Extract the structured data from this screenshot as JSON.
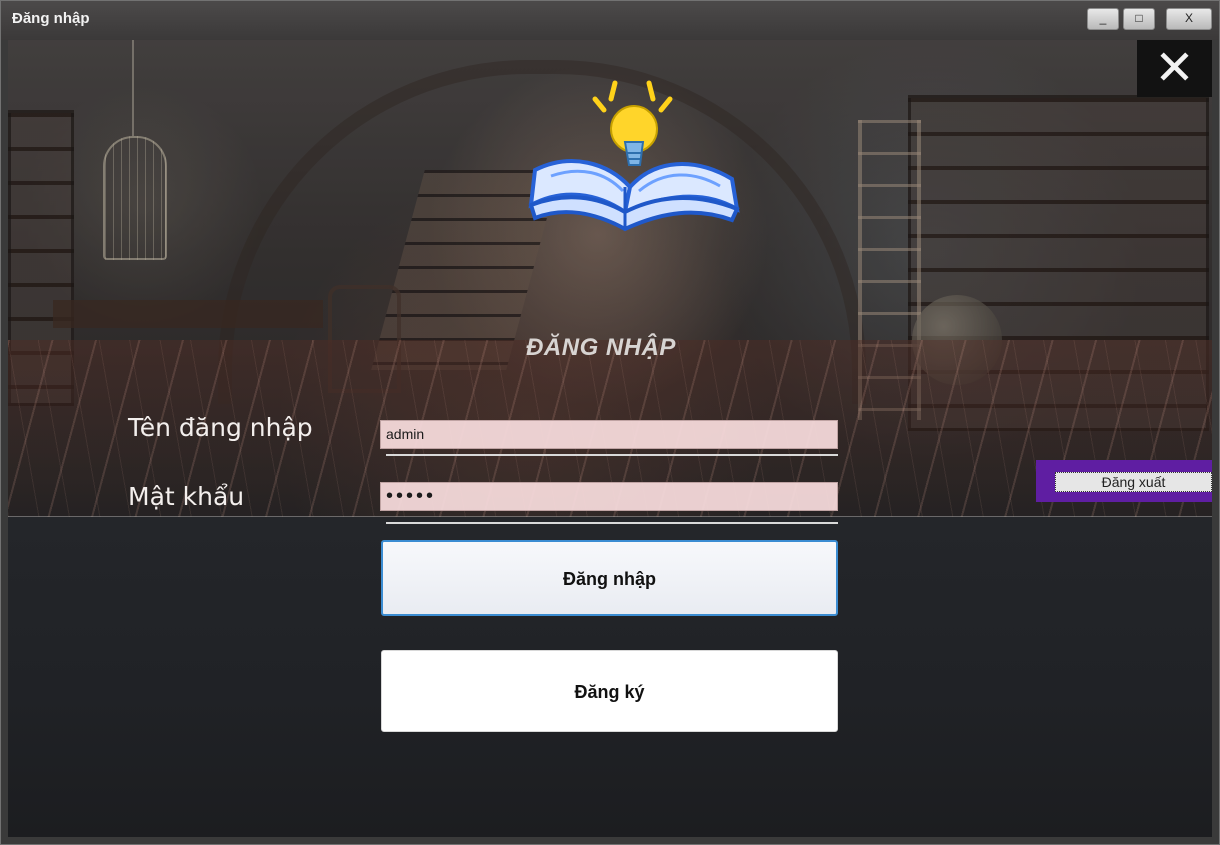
{
  "window": {
    "title": "Đăng nhập",
    "controls": {
      "minimize": "_",
      "maximize": "□",
      "close": "X"
    }
  },
  "overlay": {
    "close_symbol": "✕"
  },
  "form": {
    "heading": "ĐĂNG NHẬP",
    "username_label": "Tên đăng nhập",
    "username_value": "admin",
    "password_label": "Mật khẩu",
    "password_value": "•••••",
    "login_button": "Đăng nhập",
    "register_button": "Đăng ký"
  },
  "side": {
    "logout_button": "Đăng xuất"
  },
  "colors": {
    "accent_blue": "#3c8dd2",
    "logout_frame": "#5f1ea2",
    "input_background": "#f9ddde"
  },
  "icons": {
    "logo": "book-lightbulb-icon",
    "close": "close-icon"
  }
}
